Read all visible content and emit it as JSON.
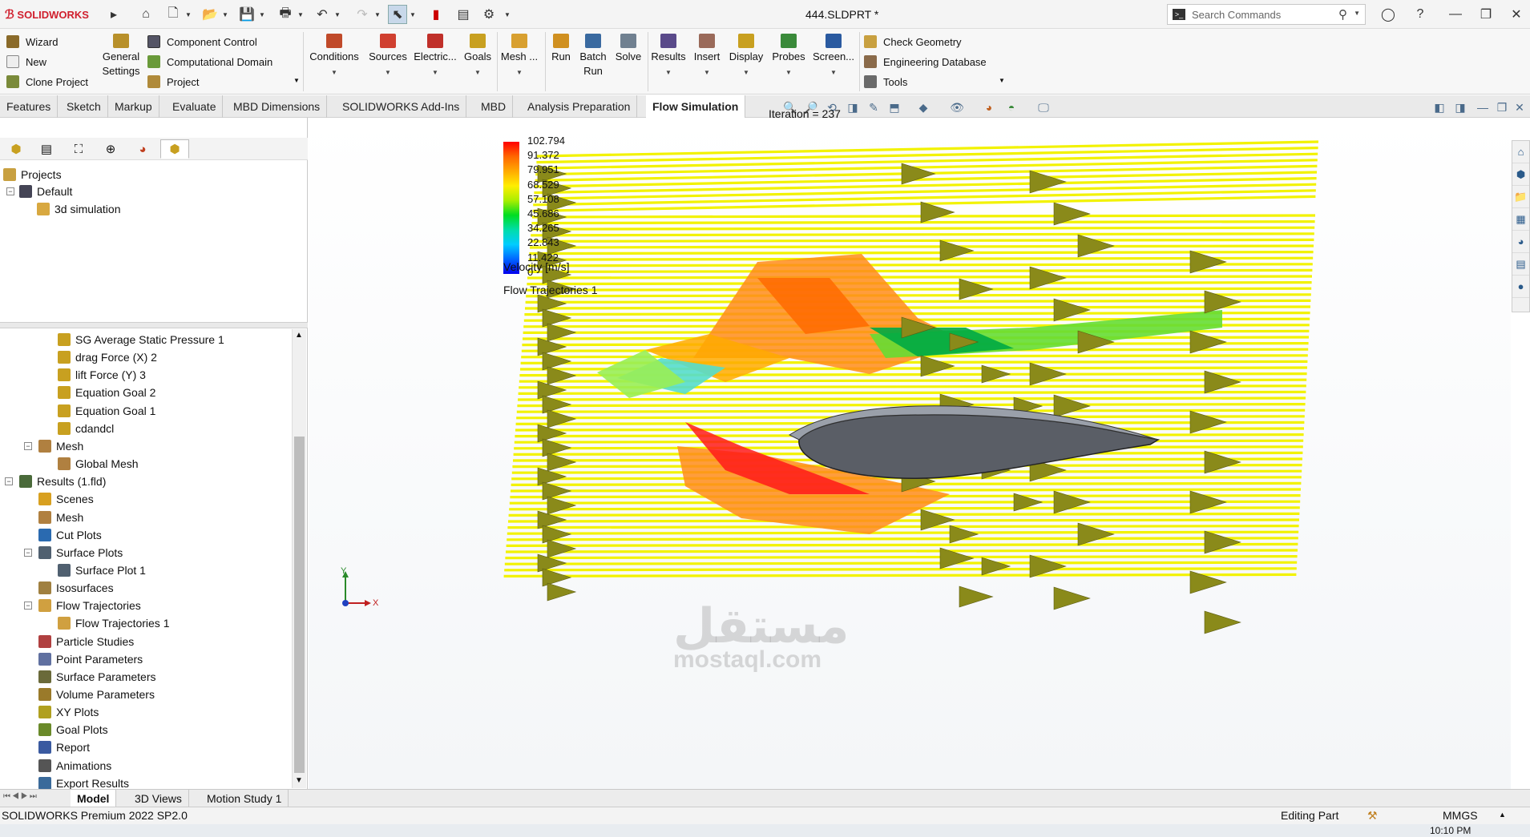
{
  "titlebar": {
    "brand": "SOLIDWORKS",
    "document_title": "444.SLDPRT *",
    "search_placeholder": "Search Commands"
  },
  "ribbon": {
    "project_group": [
      "Wizard",
      "New",
      "Clone Project"
    ],
    "general_settings": [
      "General",
      "Settings"
    ],
    "domain_group": [
      "Component Control",
      "Computational Domain",
      "Project"
    ],
    "big_buttons": [
      "Conditions",
      "Sources",
      "Electric...",
      "Goals",
      "Mesh ...",
      "Run",
      "Batch Run",
      "Solve",
      "Results",
      "Insert",
      "Display",
      "Probes",
      "Screen..."
    ],
    "batch_line1": "Batch",
    "batch_line2": "Run",
    "tools_group": [
      "Check Geometry",
      "Engineering Database",
      "Tools"
    ]
  },
  "tabs": [
    "Features",
    "Sketch",
    "Markup",
    "Evaluate",
    "MBD Dimensions",
    "SOLIDWORKS Add-Ins",
    "MBD",
    "Analysis Preparation",
    "Flow Simulation"
  ],
  "active_tab": "Flow Simulation",
  "project_tree": {
    "root": "Projects",
    "config": "Default",
    "project": "3d simulation"
  },
  "analysis_tree": [
    {
      "label": "SG Average Static Pressure 1",
      "icon": "goal-icon"
    },
    {
      "label": "drag Force (X) 2",
      "icon": "goal-icon"
    },
    {
      "label": "lift Force (Y) 3",
      "icon": "goal-icon"
    },
    {
      "label": "Equation Goal 2",
      "icon": "goal-icon"
    },
    {
      "label": "Equation Goal 1",
      "icon": "goal-icon"
    },
    {
      "label": "cdandcl",
      "icon": "goal-icon"
    },
    {
      "label": "Mesh",
      "icon": "mesh-icon"
    },
    {
      "label": "Global Mesh",
      "icon": "mesh-icon"
    },
    {
      "label": "Results (1.fld)",
      "icon": "results-icon"
    },
    {
      "label": "Scenes",
      "icon": "scenes-icon"
    },
    {
      "label": "Mesh",
      "icon": "mesh-icon"
    },
    {
      "label": "Cut Plots",
      "icon": "cut-plot-icon"
    },
    {
      "label": "Surface Plots",
      "icon": "surface-plot-icon"
    },
    {
      "label": "Surface Plot 1",
      "icon": "surface-plot-icon"
    },
    {
      "label": "Isosurfaces",
      "icon": "isosurface-icon"
    },
    {
      "label": "Flow Trajectories",
      "icon": "trajectory-icon"
    },
    {
      "label": "Flow Trajectories 1",
      "icon": "trajectory-icon"
    },
    {
      "label": "Particle Studies",
      "icon": "particle-icon"
    },
    {
      "label": "Point Parameters",
      "icon": "point-icon"
    },
    {
      "label": "Surface Parameters",
      "icon": "surface-param-icon"
    },
    {
      "label": "Volume Parameters",
      "icon": "volume-icon"
    },
    {
      "label": "XY Plots",
      "icon": "xy-plot-icon"
    },
    {
      "label": "Goal Plots",
      "icon": "goal-plot-icon"
    },
    {
      "label": "Report",
      "icon": "report-icon"
    },
    {
      "label": "Animations",
      "icon": "animation-icon"
    },
    {
      "label": "Export Results",
      "icon": "export-icon"
    }
  ],
  "viewport": {
    "iteration": "Iteration = 237",
    "legend_values": [
      "102.794",
      "91.372",
      "79.951",
      "68.529",
      "57.108",
      "45.686",
      "34.265",
      "22.843",
      "11.422",
      "0"
    ],
    "legend_title": "Velocity [m/s]",
    "plot_name": "Flow Trajectories 1",
    "legend_colors": [
      "#ff0000",
      "#ff6600",
      "#ffaa00",
      "#ffee00",
      "#aaee00",
      "#00dd22",
      "#00ddaa",
      "#00ccff",
      "#0066ff",
      "#0000ee"
    ],
    "axis_x": "X",
    "axis_y": "Y"
  },
  "watermark": {
    "arabic": "مستقل",
    "latin": "mostaql.com"
  },
  "bottom_tabs": [
    "Model",
    "3D Views",
    "Motion Study 1"
  ],
  "status": {
    "product": "SOLIDWORKS Premium 2022 SP2.0",
    "mode": "Editing Part",
    "units": "MMGS",
    "time": "10:10 PM"
  }
}
